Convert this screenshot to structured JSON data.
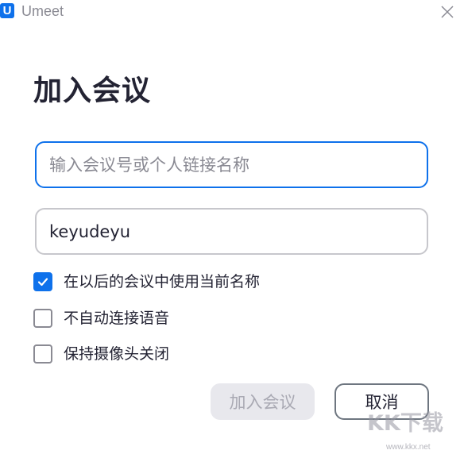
{
  "app": {
    "logo_letter": "U",
    "title": "Umeet"
  },
  "dialog": {
    "heading": "加入会议",
    "meeting_input": {
      "value": "",
      "placeholder": "输入会议号或个人链接名称"
    },
    "name_input": {
      "value": "keyudeyu",
      "placeholder": ""
    },
    "options": [
      {
        "label": "在以后的会议中使用当前名称",
        "checked": true
      },
      {
        "label": "不自动连接语音",
        "checked": false
      },
      {
        "label": "保持摄像头关闭",
        "checked": false
      }
    ],
    "join_label": "加入会议",
    "cancel_label": "取消"
  },
  "watermark": {
    "text": "KK下载",
    "url": "www.kkx.net"
  },
  "colors": {
    "accent": "#0e71eb",
    "text": "#232333",
    "placeholder": "#8a8a93",
    "disabled_bg": "#e8e8ed",
    "disabled_text": "#a9a9b3"
  },
  "icons": {
    "close": "close-icon",
    "check": "check-icon"
  }
}
